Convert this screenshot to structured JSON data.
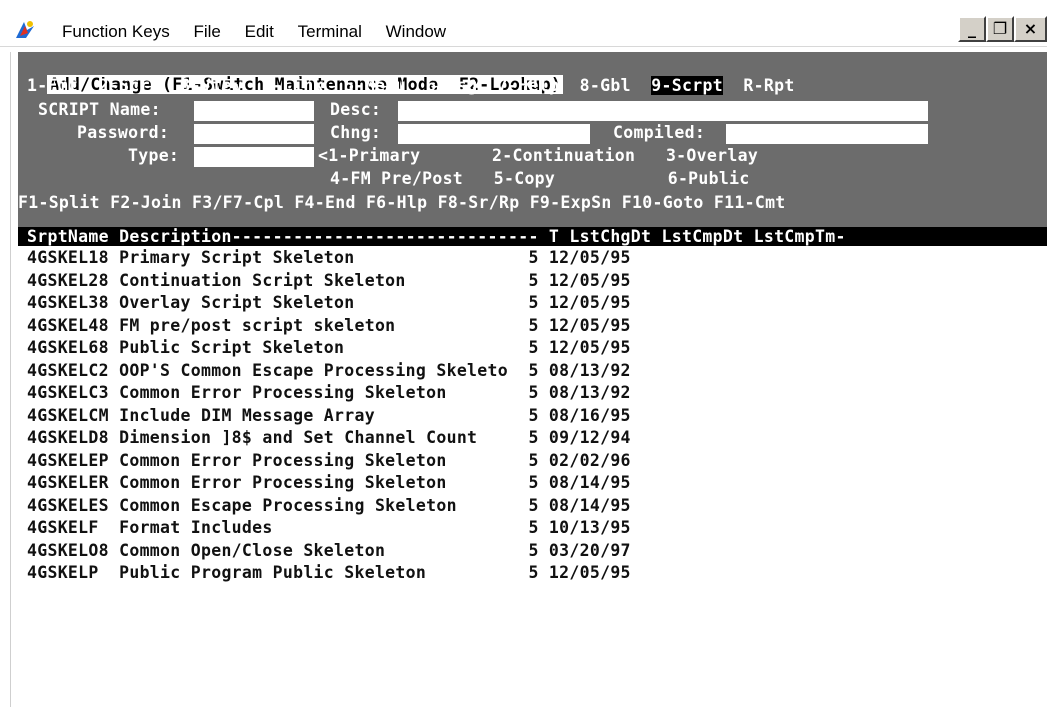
{
  "window": {
    "menu": [
      "Function Keys",
      "File",
      "Edit",
      "Terminal",
      "Window"
    ],
    "controls": [
      "_",
      "❐",
      "×"
    ]
  },
  "terminal": {
    "mode_line": "Add/Change (F1-Switch Maintenance Mode  F2-Lookup)",
    "tabs": [
      "1-Fmt",
      "2-Scrn",
      "3-View",
      "4-Link",
      "5-Menu",
      "6-Msg",
      "7-Help",
      "8-Gbl",
      "9-Scrpt",
      "R-Rpt"
    ],
    "selected_tab": "9-Scrpt",
    "fields": {
      "script_name_label": "SCRIPT Name:",
      "desc_label": "Desc:",
      "password_label": "Password:",
      "chng_label": "Chng:",
      "compiled_label": "Compiled:",
      "type_label": "Type:",
      "type_options_row1": "<1-Primary       2-Continuation   3-Overlay",
      "type_options_row2": "4-FM Pre/Post   5-Copy           6-Public"
    },
    "function_keys": "F1-Split F2-Join F3/F7-Cpl F4-End F6-Hlp F8-Sr/Rp F9-ExpSn F10-Goto F11-Cmt",
    "table_header": "SrptName Description------------------------------ T LstChgDt LstCmpDt LstCmpTm-",
    "rows": [
      {
        "name": "4GSKEL18",
        "desc": "Primary Script Skeleton",
        "t": "5",
        "date": "12/05/95"
      },
      {
        "name": "4GSKEL28",
        "desc": "Continuation Script Skeleton",
        "t": "5",
        "date": "12/05/95"
      },
      {
        "name": "4GSKEL38",
        "desc": "Overlay Script Skeleton",
        "t": "5",
        "date": "12/05/95"
      },
      {
        "name": "4GSKEL48",
        "desc": "FM pre/post script skeleton",
        "t": "5",
        "date": "12/05/95"
      },
      {
        "name": "4GSKEL68",
        "desc": "Public Script Skeleton",
        "t": "5",
        "date": "12/05/95"
      },
      {
        "name": "4GSKELC2",
        "desc": "OOP'S Common Escape Processing Skeleto",
        "t": "5",
        "date": "08/13/92"
      },
      {
        "name": "4GSKELC3",
        "desc": "Common Error Processing Skeleton",
        "t": "5",
        "date": "08/13/92"
      },
      {
        "name": "4GSKELCM",
        "desc": "Include DIM Message Array",
        "t": "5",
        "date": "08/16/95"
      },
      {
        "name": "4GSKELD8",
        "desc": "Dimension ]8$ and Set Channel Count",
        "t": "5",
        "date": "09/12/94"
      },
      {
        "name": "4GSKELEP",
        "desc": "Common Error Processing Skeleton",
        "t": "5",
        "date": "02/02/96"
      },
      {
        "name": "4GSKELER",
        "desc": "Common Error Processing Skeleton",
        "t": "5",
        "date": "08/14/95"
      },
      {
        "name": "4GSKELES",
        "desc": "Common Escape Processing Skeleton",
        "t": "5",
        "date": "08/14/95"
      },
      {
        "name": "4GSKELF",
        "desc": "Format Includes",
        "t": "5",
        "date": "10/13/95"
      },
      {
        "name": "4GSKELO8",
        "desc": "Common Open/Close Skeleton",
        "t": "5",
        "date": "03/20/97"
      },
      {
        "name": "4GSKELP",
        "desc": "Public Program Public Skeleton",
        "t": "5",
        "date": "12/05/95"
      }
    ]
  },
  "colors": {
    "panel": "#6c6c6c",
    "header": "#000000",
    "text_light": "#ffffff",
    "text_dark": "#111111"
  }
}
